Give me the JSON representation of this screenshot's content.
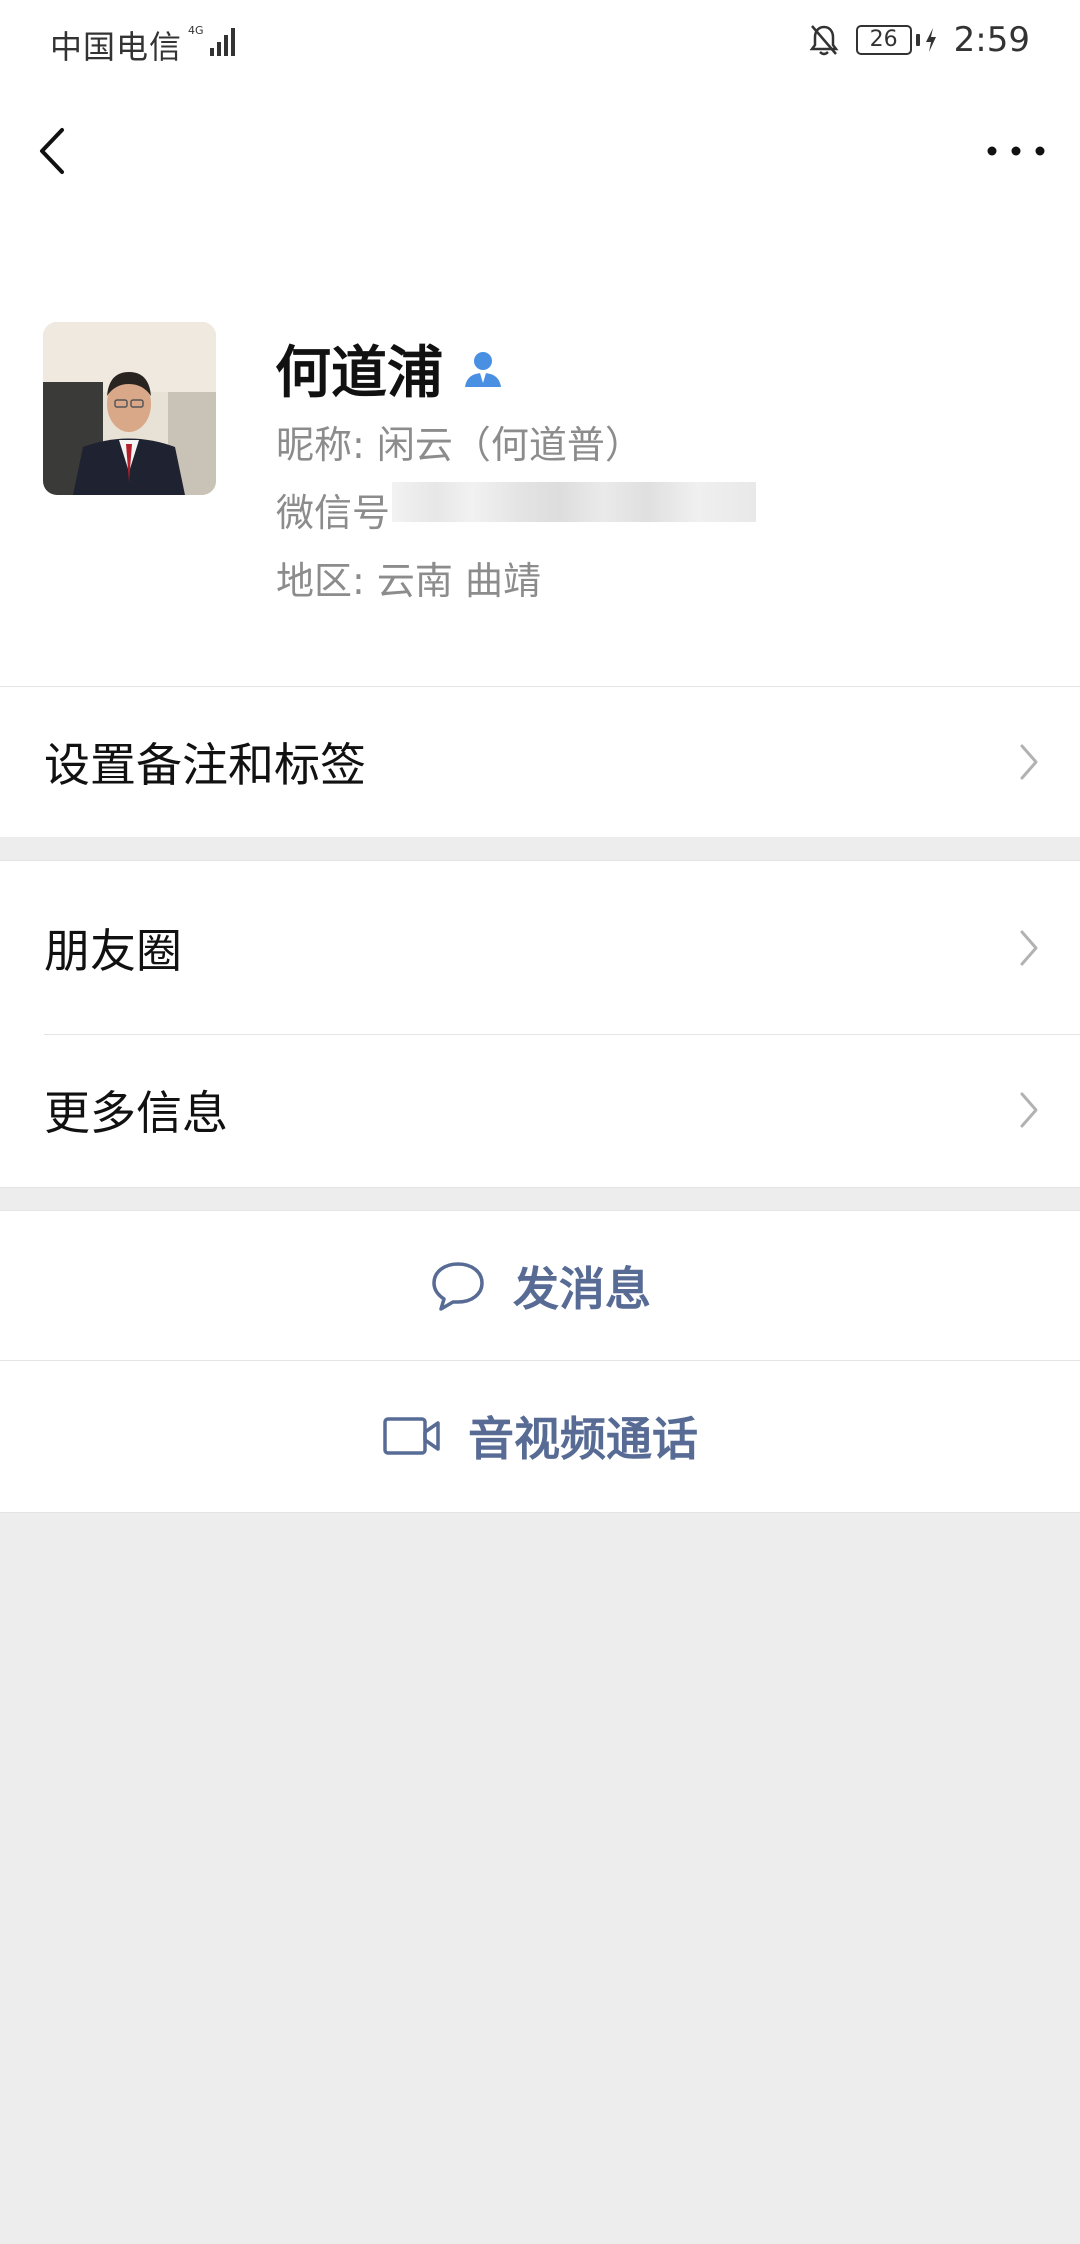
{
  "status_bar": {
    "carrier": "中国电信",
    "network": "4G",
    "battery": "26",
    "time": "2:59"
  },
  "nav": {
    "back_icon": "chevron-left-icon",
    "more_icon": "more-horizontal-icon"
  },
  "profile": {
    "name": "何道浦",
    "nickname_line": "昵称: 闲云（何道普）",
    "wechat_id_label": "微信号",
    "region_line": "地区: 云南  曲靖"
  },
  "menu": {
    "remark_tags": "设置备注和标签",
    "moments": "朋友圈",
    "more_info": "更多信息"
  },
  "actions": {
    "send_message": "发消息",
    "video_call": "音视频通话"
  },
  "colors": {
    "accent": "#576b95",
    "background": "#ededed",
    "verify_blue": "#4a90e2"
  }
}
